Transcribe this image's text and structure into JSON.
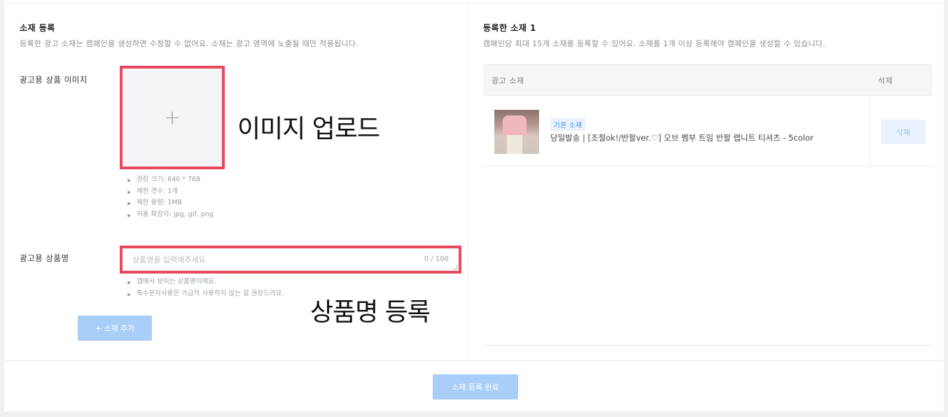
{
  "left_section": {
    "title": "소재 등록",
    "description": "등록한 광고 소재는 캠페인을 생성하면 수정할 수 없어요. 소재는 광고 영역에 노출될 때만 적용됩니다.",
    "image_label": "광고용 상품 이미지",
    "image_upload_icon": "plus-icon",
    "image_hints": [
      "권장 크기: 640 * 768",
      "제한 갯수: 1개",
      "제한 용량: 1MB",
      "허용 확장자: jpg, gif, png"
    ],
    "name_label": "광고용 상품명",
    "name_input": {
      "value": "",
      "placeholder": "상품명을 입력해주세요",
      "counter": "0 / 100"
    },
    "name_hints": [
      "앱에서 보이는 상품명이에요.",
      "특수문자사용은 가급적 사용하지 않는 걸 권장드려요."
    ],
    "add_button": "+ 소재 추가"
  },
  "annotations": {
    "image_upload": "이미지 업로드",
    "name_register": "상품명 등록",
    "color": "#e8495f"
  },
  "right_section": {
    "title": "등록한 소재 1",
    "description": "캠페인당 최대 15개 소재를 등록할 수 있어요. 소재를 1개 이상 등록해야 캠페인을 생성할 수 있습니다.",
    "table": {
      "headers": [
        "광고 소재",
        "삭제"
      ],
      "rows": [
        {
          "badge": "기본 소재",
          "product_name": "당일발송 | [조절ok!/반팔ver.♡] 오브 벰부 트임 반팔 랩니트 티셔츠 - 5color",
          "delete_label": "삭제"
        }
      ]
    }
  },
  "footer": {
    "complete_button": "소재 등록 완료"
  },
  "colors": {
    "primary_button": "#a9cff8",
    "badge_text": "#3d8ee8"
  }
}
